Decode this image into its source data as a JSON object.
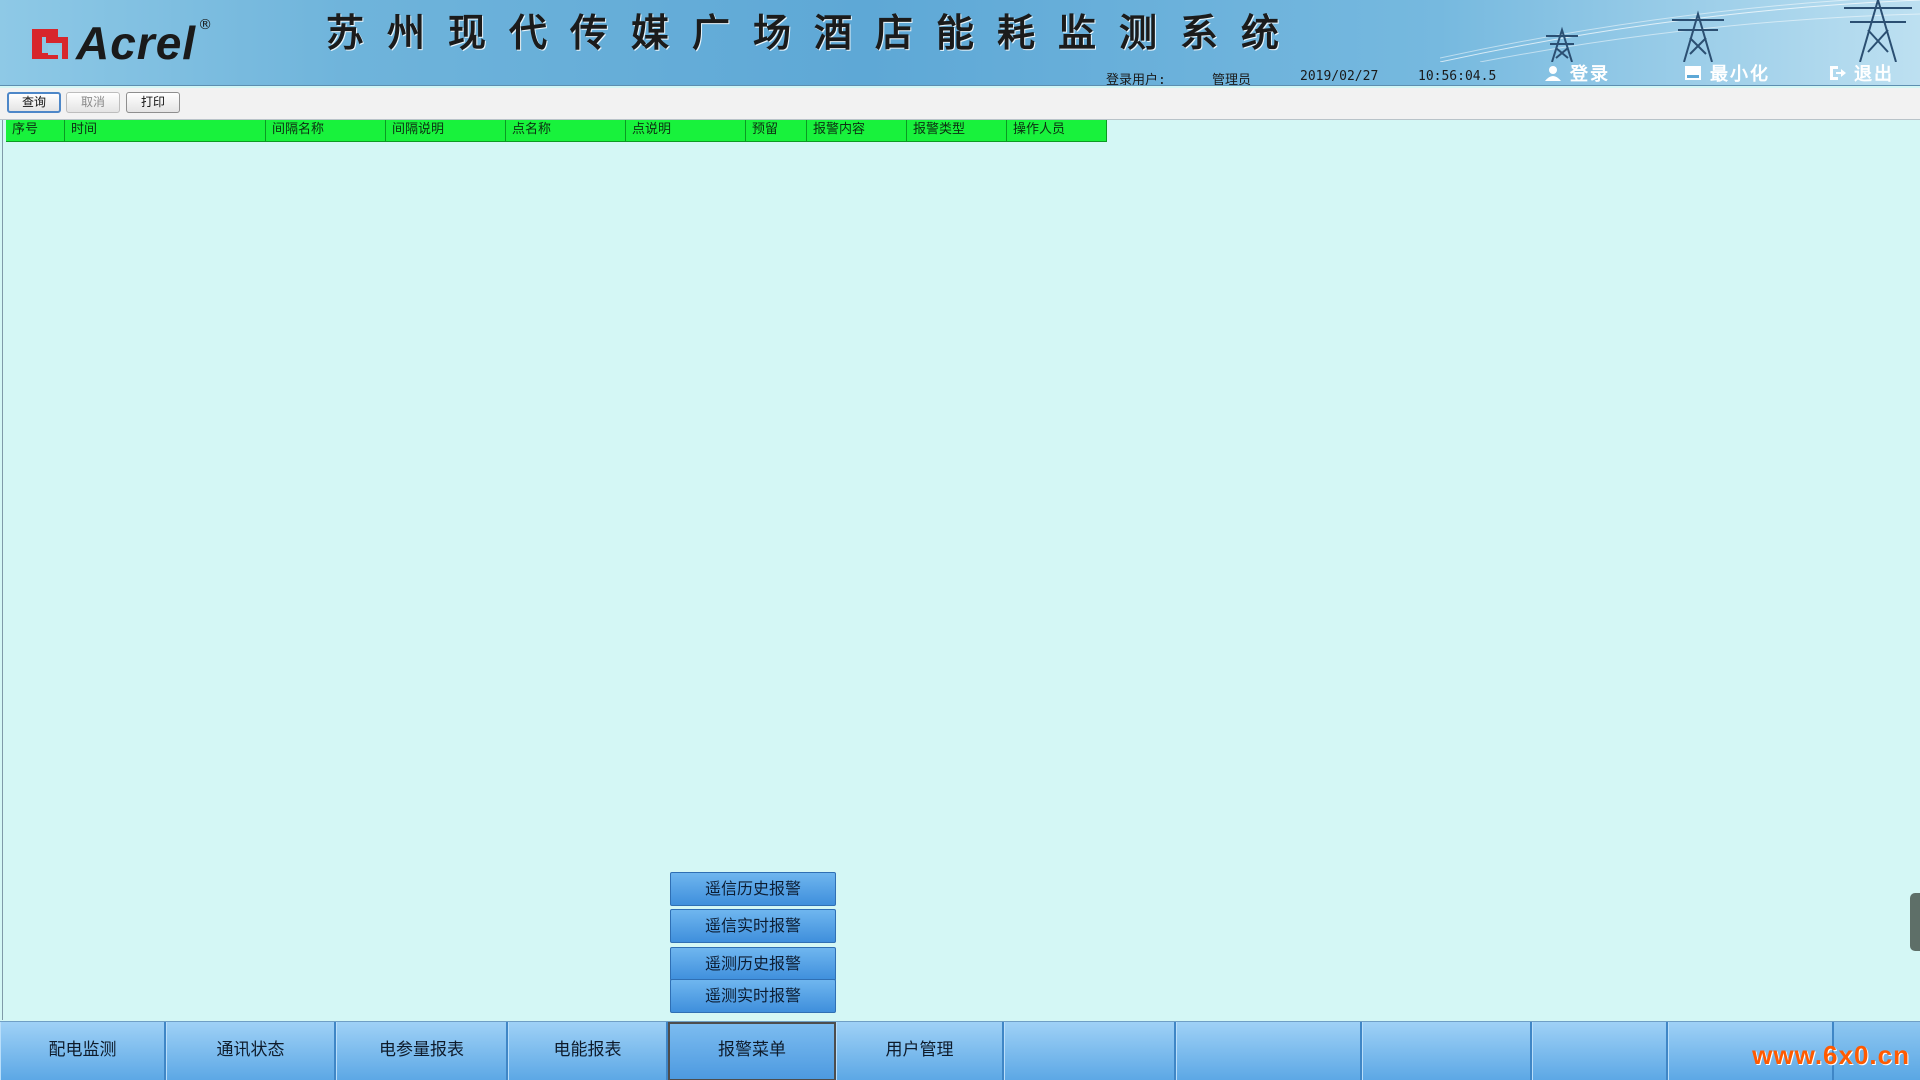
{
  "app": {
    "logo_text": "Acrel",
    "logo_reg": "®",
    "title": "苏州现代传媒广场酒店能耗监测系统"
  },
  "status": {
    "user_label": "登录用户:",
    "user_name": "管理员",
    "date": "2019/02/27",
    "time": "10:56:04.5"
  },
  "header_actions": {
    "login": "登录",
    "minimize": "最小化",
    "exit": "退出"
  },
  "toolbar": {
    "query": "查询",
    "cancel": "取消",
    "print": "打印"
  },
  "table": {
    "columns": [
      "序号",
      "时间",
      "间隔名称",
      "间隔说明",
      "点名称",
      "点说明",
      "预留",
      "报警内容",
      "报警类型",
      "操作人员"
    ],
    "header_color": "#18f23c",
    "rows": []
  },
  "alarm_menu": {
    "items": [
      "遥信历史报警",
      "遥信实时报警",
      "遥测历史报警",
      "遥测实时报警"
    ]
  },
  "bottom_nav": {
    "items": [
      "配电监测",
      "通讯状态",
      "电参量报表",
      "电能报表",
      "报警菜单",
      "用户管理",
      "",
      "",
      "",
      "",
      ""
    ],
    "active": "报警菜单"
  },
  "watermark": "www.6x0.cn",
  "colors": {
    "background": "#d4f7f5",
    "header_blue": "#5ea8d6",
    "nav_blue": "#5aa7e4",
    "logo_red": "#d7262c"
  }
}
